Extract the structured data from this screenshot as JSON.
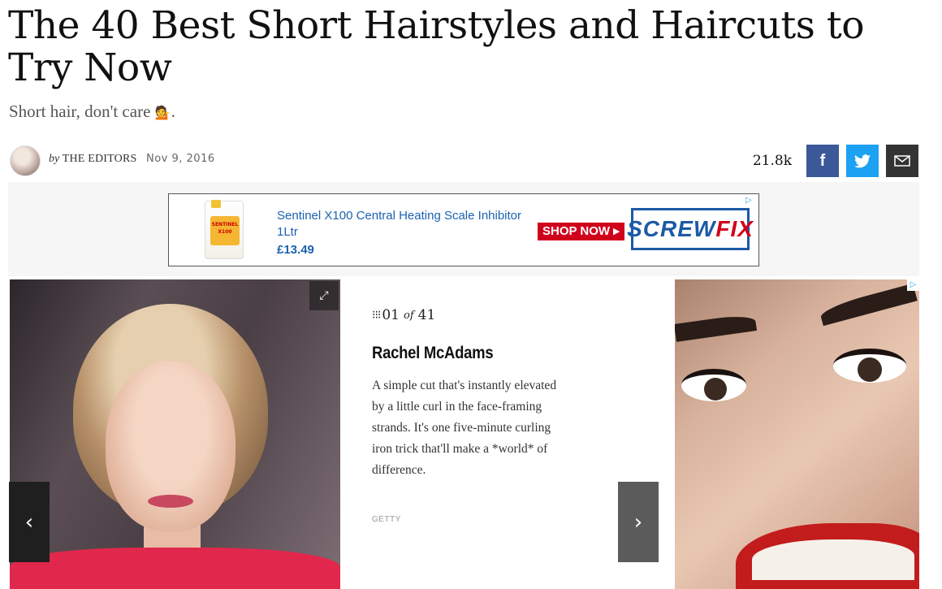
{
  "article": {
    "title": "The 40 Best Short Hairstyles and Haircuts to Try Now",
    "subtitle": "Short hair, don't care",
    "subtitle_emoji": "💁",
    "subtitle_end": ".",
    "byline_prefix": "by",
    "author": "THE EDITORS",
    "date": "Nov 9, 2016"
  },
  "share": {
    "count": "21.8k",
    "facebook_icon": "f",
    "twitter_icon": "🐦",
    "email_icon": "✉"
  },
  "ad_banner": {
    "product_text": "Sentinel X100 Central Heating Scale Inhibitor 1Ltr",
    "price": "£13.49",
    "cta": "SHOP NOW ▸",
    "brand_main": "SCREW",
    "brand_accent": "FIX",
    "product_label": "SENTINEL X100",
    "ad_choices_icon": "▷"
  },
  "slideshow": {
    "expand_icon": "⤢",
    "prev_icon": "‹",
    "next_icon": "›",
    "grid_icon": "⁝⁝⁝",
    "current": "01",
    "of_label": "of",
    "total": "41",
    "slide_title": "Rachel McAdams",
    "description": "A simple cut that's instantly elevated by a little curl in the face-framing strands. It's one five-minute curling iron trick that'll make a *world* of difference.",
    "credit": "GETTY"
  },
  "side_ad": {
    "ad_choices_icon": "▷"
  }
}
